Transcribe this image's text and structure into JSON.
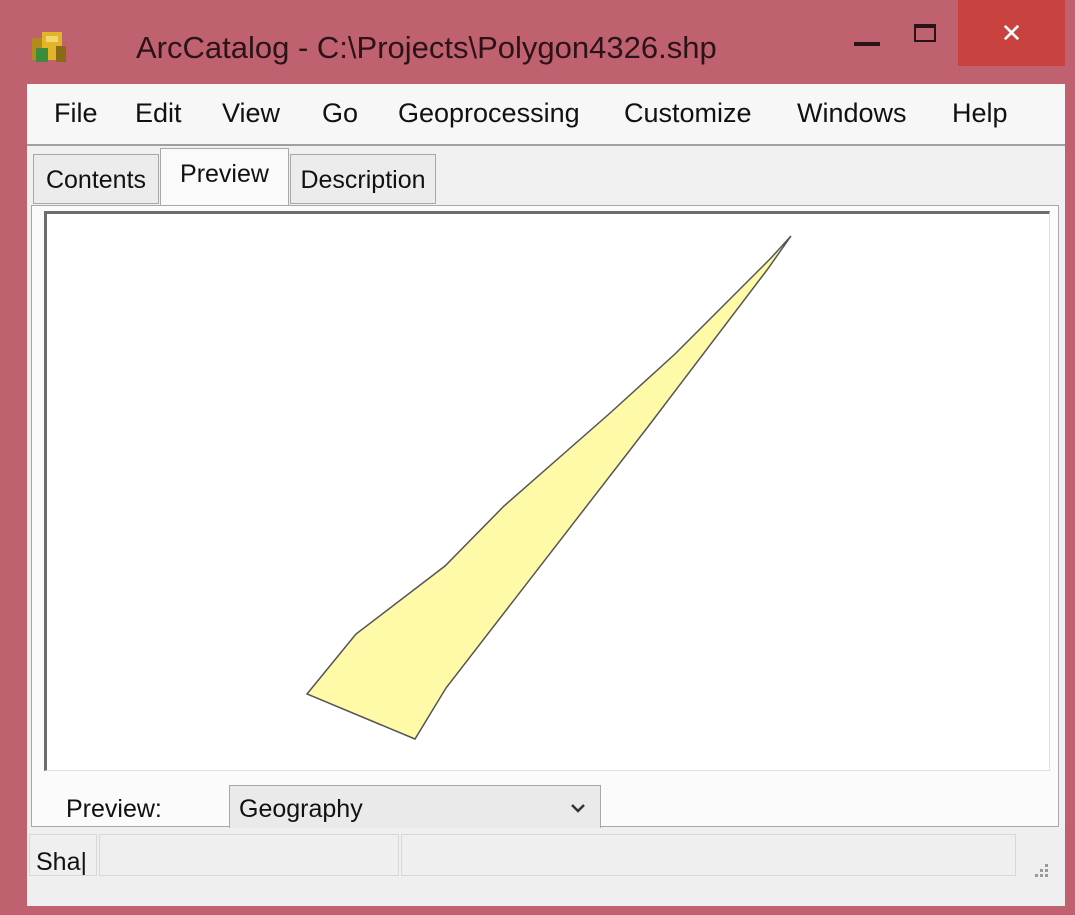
{
  "window": {
    "title": "ArcCatalog - C:\\Projects\\Polygon4326.shp",
    "close_label": "✕",
    "accent_color": "#c06170",
    "close_color": "#c8433f"
  },
  "menu": {
    "items": [
      "File",
      "Edit",
      "View",
      "Go",
      "Geoprocessing",
      "Customize",
      "Windows",
      "Help"
    ]
  },
  "tabs": {
    "items": [
      {
        "label": "Contents",
        "active": false
      },
      {
        "label": "Preview",
        "active": true
      },
      {
        "label": "Description",
        "active": false
      }
    ]
  },
  "preview": {
    "label": "Preview:",
    "mode_value": "Geography",
    "shape_fill": "#fffaa8",
    "shape_stroke": "#555555"
  },
  "status": {
    "text": "Sha|"
  },
  "icons": {
    "app": "arccatalog-icon",
    "minimize": "minimize-icon",
    "maximize": "maximize-icon",
    "close": "close-icon",
    "dropdown": "chevron-down-icon",
    "grip": "resize-grip-icon"
  }
}
